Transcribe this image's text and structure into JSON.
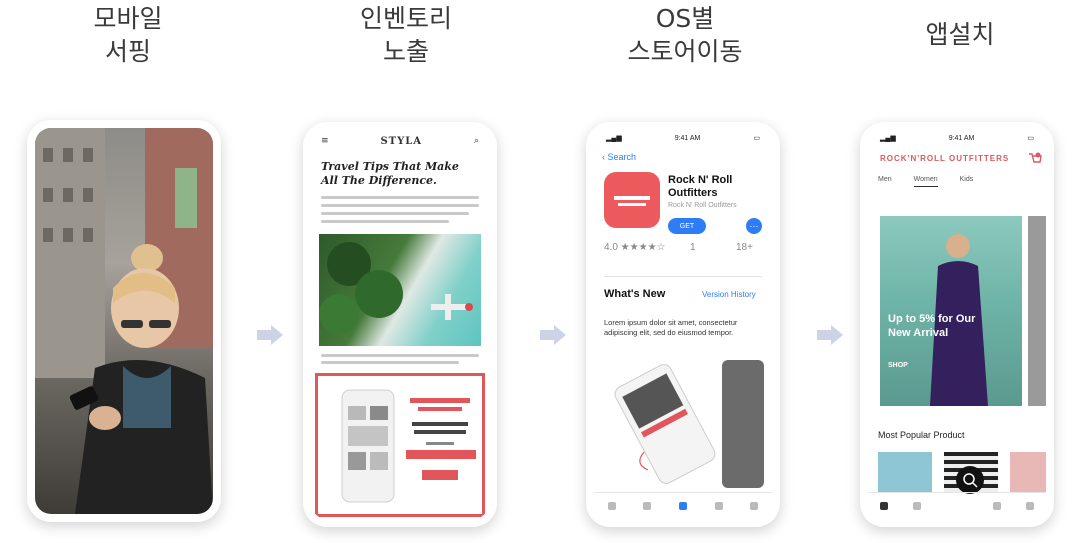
{
  "steps": [
    {
      "title_line1": "모바일",
      "title_line2": "서핑"
    },
    {
      "title_line1": "인벤토리",
      "title_line2": "노출"
    },
    {
      "title_line1": "OS별",
      "title_line2": "스토어이동"
    },
    {
      "title_line1": "앱설치",
      "title_line2": ""
    }
  ],
  "colors": {
    "accent_red": "#e2555a",
    "ios_blue": "#2f7df6",
    "arrow": "#cdd3e6"
  },
  "icons": [
    "arrow-right-icon",
    "search-icon",
    "cart-icon"
  ],
  "phone2": {
    "brand": "STYLA",
    "headline": "Travel Tips That Make All The Difference."
  },
  "phone3": {
    "status_time": "9:41 AM",
    "back_label": "Search",
    "app_name": "Rock N' Roll Outfitters",
    "app_sub": "Rock N' Roll Outfitters",
    "get_label": "GET",
    "more_label": "···",
    "rating": "4.0 ★★★★☆",
    "rank": "1",
    "age": "18+",
    "whats_new": "What's New",
    "version_history": "Version History",
    "description": "Lorem ipsum dolor sit amet, consectetur adipiscing elit, sed do eiusmod tempor."
  },
  "phone4": {
    "status_time": "9:41 AM",
    "brand": "ROCK'N'ROLL OUTFITTERS",
    "tabs": [
      "Men",
      "Women",
      "Kids"
    ],
    "banner_text_line1": "Up to 5% for Our",
    "banner_text_line2": "New Arrival",
    "shop_label": "SHOP",
    "popular_title": "Most Popular Product"
  }
}
